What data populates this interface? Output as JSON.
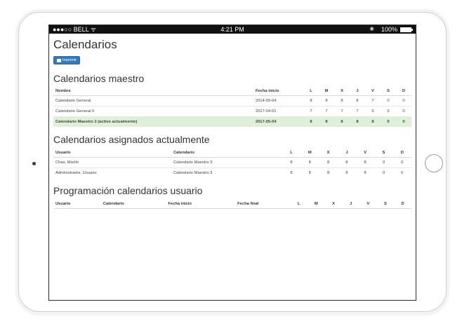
{
  "statusbar": {
    "carrier": "●●●○○ BELL ᯤ",
    "time": "4:21 PM",
    "battery": "100%"
  },
  "page": {
    "title": "Calendarios",
    "print_label": "Imprimir"
  },
  "maestros": {
    "title": "Calendarios maestro",
    "headers": [
      "Nombre",
      "Fecha inicio",
      "L",
      "M",
      "X",
      "J",
      "V",
      "S",
      "D"
    ],
    "rows": [
      {
        "nombre": "Calendario General",
        "fecha": "2014-09-04",
        "L": "8",
        "M": "8",
        "X": "8",
        "J": "8",
        "V": "7",
        "S": "0",
        "D": "0"
      },
      {
        "nombre": "Calendario General II",
        "fecha": "2017-04-01",
        "L": "7",
        "M": "7",
        "X": "7",
        "J": "7",
        "V": "6",
        "S": "5",
        "D": "0"
      },
      {
        "nombre": "Calendario Maestro 3 (activo actualmente)",
        "fecha": "2017-05-04",
        "L": "8",
        "M": "8",
        "X": "8",
        "J": "8",
        "V": "8",
        "S": "0",
        "D": "0"
      }
    ]
  },
  "asignados": {
    "title": "Calendarios asignados actualmente",
    "headers": [
      "Usuario",
      "Calendario",
      "L",
      "M",
      "X",
      "J",
      "V",
      "S",
      "D"
    ],
    "rows": [
      {
        "usuario": "Chas, Martín",
        "calendario": "Calendario Maestro 3",
        "L": "8",
        "M": "8",
        "X": "8",
        "J": "8",
        "V": "8",
        "S": "0",
        "D": "0"
      },
      {
        "usuario": "Administrador, Usuario",
        "calendario": "Calendario Maestro 3",
        "L": "8",
        "M": "8",
        "X": "8",
        "J": "8",
        "V": "8",
        "S": "0",
        "D": "0"
      }
    ]
  },
  "programacion": {
    "title": "Programación calendarios usuario",
    "headers": [
      "Usuario",
      "Calendario",
      "Fecha inicio",
      "Fecha final",
      "L",
      "M",
      "X",
      "J",
      "V",
      "S",
      "D"
    ]
  }
}
